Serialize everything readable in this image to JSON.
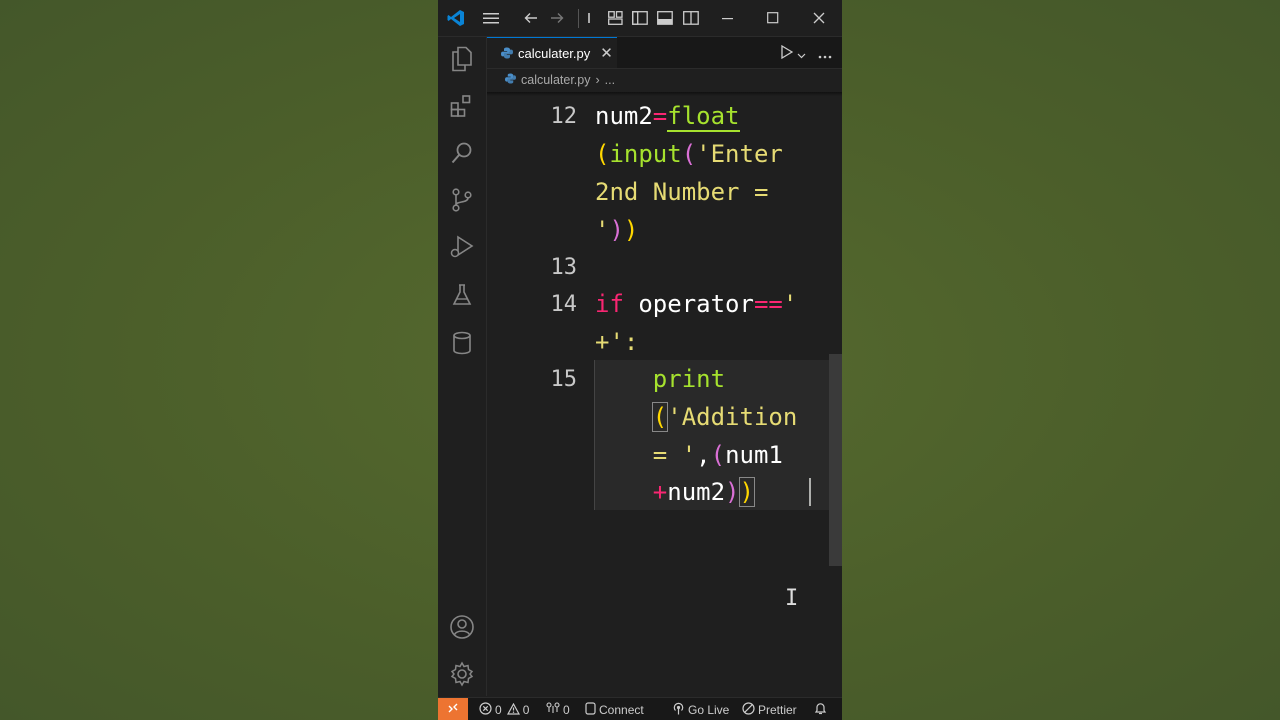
{
  "colors": {
    "accent": "#0078d4",
    "remote_bg": "#ed7431",
    "background": "#4b5e2a"
  },
  "tab": {
    "filename": "calculater.py",
    "close": "✕"
  },
  "breadcrumb": {
    "file": "calculater.py",
    "sep": "›",
    "more": "..."
  },
  "editor": {
    "lines": [
      {
        "num": "12",
        "tokens": [
          {
            "t": "num2",
            "c": "k-var"
          },
          {
            "t": "=",
            "c": "k-op"
          },
          {
            "t": "float",
            "c": "k-fn"
          }
        ]
      },
      {
        "num": "",
        "tokens": [
          {
            "t": "(",
            "c": "k-par1"
          },
          {
            "t": "input",
            "c": "k-fn"
          },
          {
            "t": "(",
            "c": "k-par2"
          },
          {
            "t": "'Enter",
            "c": "k-str"
          }
        ]
      },
      {
        "num": "",
        "tokens": [
          {
            "t": "2nd Number =",
            "c": "k-str"
          }
        ]
      },
      {
        "num": "",
        "tokens": [
          {
            "t": "'",
            "c": "k-str"
          },
          {
            "t": ")",
            "c": "k-par2"
          },
          {
            "t": ")",
            "c": "k-par1"
          }
        ]
      },
      {
        "num": "13",
        "tokens": []
      },
      {
        "num": "14",
        "tokens": [
          {
            "t": "if",
            "c": "k-kw"
          },
          {
            "t": " operator",
            "c": "k-var"
          },
          {
            "t": "==",
            "c": "k-op"
          },
          {
            "t": "'",
            "c": "k-str"
          }
        ]
      },
      {
        "num": "",
        "tokens": [
          {
            "t": "+':",
            "c": "k-str"
          }
        ]
      },
      {
        "num": "15",
        "tokens": [
          {
            "t": "    print",
            "c": "k-fn"
          }
        ]
      },
      {
        "num": "",
        "tokens": [
          {
            "t": "    ",
            "c": "k-var"
          },
          {
            "t": "(",
            "c": "k-par1"
          },
          {
            "t": "'Addition",
            "c": "k-str"
          }
        ]
      },
      {
        "num": "",
        "tokens": [
          {
            "t": "    = '",
            "c": "k-str"
          },
          {
            "t": ",",
            "c": "k-var"
          },
          {
            "t": "(",
            "c": "k-par2"
          },
          {
            "t": "num1",
            "c": "k-var"
          }
        ]
      },
      {
        "num": "",
        "tokens": [
          {
            "t": "    ",
            "c": "k-var"
          },
          {
            "t": "+",
            "c": "k-op"
          },
          {
            "t": "num2",
            "c": "k-var"
          },
          {
            "t": ")",
            "c": "k-par2"
          },
          {
            "t": ")",
            "c": "k-par1"
          }
        ]
      }
    ]
  },
  "status": {
    "errors": "0",
    "warnings": "0",
    "ports": "0",
    "connect": "Connect",
    "golive": "Go Live",
    "prettier": "Prettier"
  },
  "icons": {
    "title_bar": [
      "vscode-logo-icon",
      "menu-icon",
      "back-arrow-icon",
      "forward-arrow-icon",
      "customize-layout-icon",
      "toggle-primary-sidebar-icon",
      "toggle-panel-icon",
      "toggle-secondary-sidebar-icon",
      "minimize-icon",
      "maximize-icon",
      "close-icon"
    ],
    "activity_bar": [
      "explorer-icon",
      "extensions-icon",
      "search-icon",
      "source-control-icon",
      "run-debug-icon",
      "testing-icon",
      "database-icon",
      "accounts-icon",
      "settings-gear-icon"
    ]
  }
}
